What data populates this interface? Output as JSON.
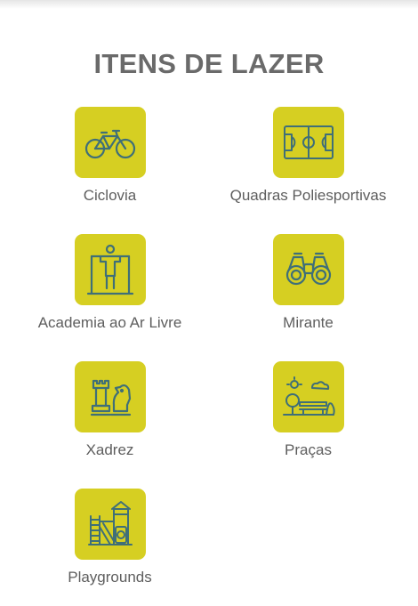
{
  "title": "ITENS DE LAZER",
  "colors": {
    "tile_background": "#d6cf22",
    "icon_stroke": "#3f6f78",
    "title_text": "#6a6a6a",
    "label_text": "#5e5e5e"
  },
  "items": [
    {
      "label": "Ciclovia",
      "icon": "bicycle-icon"
    },
    {
      "label": "Quadras Poliesportivas",
      "icon": "sports-court-icon"
    },
    {
      "label": "Academia ao Ar Livre",
      "icon": "outdoor-gym-icon"
    },
    {
      "label": "Mirante",
      "icon": "binoculars-icon"
    },
    {
      "label": "Xadrez",
      "icon": "chess-icon"
    },
    {
      "label": "Praças",
      "icon": "park-icon"
    },
    {
      "label": "Playgrounds",
      "icon": "playground-icon"
    }
  ]
}
